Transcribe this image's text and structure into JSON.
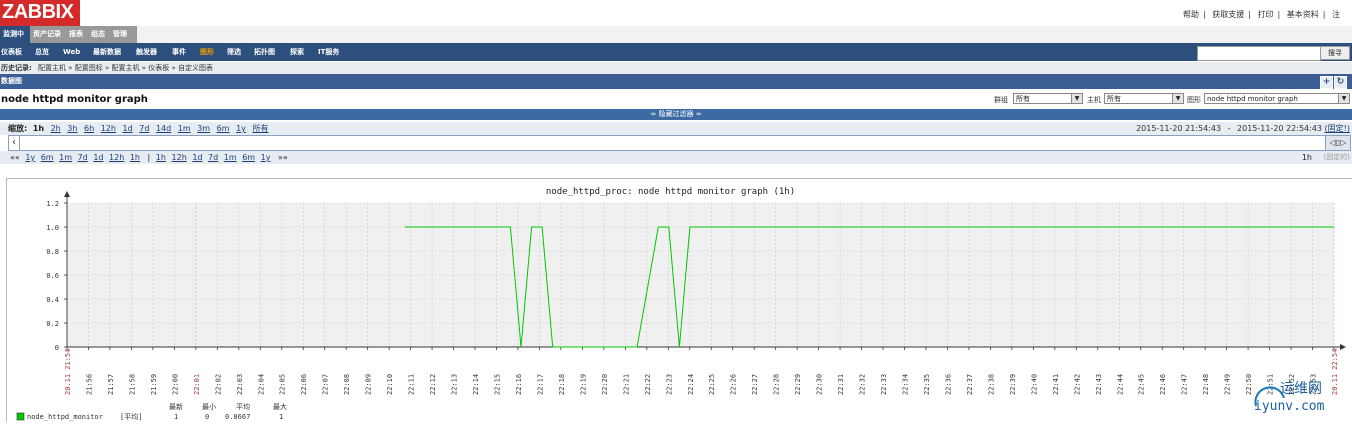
{
  "header": {
    "logo": "ZABBIX",
    "top_links": [
      "帮助",
      "获取支援",
      "打印",
      "基本资料",
      "注"
    ]
  },
  "topnav": [
    {
      "label": "监测中",
      "active": true
    },
    {
      "label": "资产记录"
    },
    {
      "label": "报表"
    },
    {
      "label": "组态"
    },
    {
      "label": "管理"
    }
  ],
  "menu": [
    "仪表板",
    "总览",
    "Web",
    "最新数据",
    "触发器",
    "事件",
    "图形",
    "筛选",
    "拓扑图",
    "探索",
    "IT服务"
  ],
  "menu_active_index": 6,
  "search": {
    "value": "",
    "button": "搜寻"
  },
  "history": {
    "label": "历史记录:",
    "items": [
      "配置主机",
      "配置图标",
      "配置主机",
      "仪表板",
      "自定义图表"
    ]
  },
  "section_title": "数据图",
  "page_title": "node httpd monitor graph",
  "filters": {
    "group_label": "群组",
    "group_value": "所有",
    "host_label": "主机",
    "host_value": "所有",
    "graph_label": "图形",
    "graph_value": "node httpd monitor graph"
  },
  "filter_toggle": "≈ 隐藏过滤器 ≈",
  "zoom": {
    "label": "缩放:",
    "options": [
      "1h",
      "2h",
      "3h",
      "6h",
      "12h",
      "1d",
      "7d",
      "14d",
      "1m",
      "3m",
      "6m",
      "1y",
      "所有"
    ],
    "active": "1h",
    "range_from": "2015-11-20 21:54:43",
    "range_sep": "-",
    "range_to": "2015-11-20 22:54:43",
    "range_tag": "(固定!)"
  },
  "period": {
    "back": "««",
    "back_options": [
      "1y",
      "6m",
      "1m",
      "7d",
      "1d",
      "12h",
      "1h"
    ],
    "sep": "|",
    "fwd_options": [
      "1h",
      "12h",
      "1d",
      "7d",
      "1m",
      "6m",
      "1y"
    ],
    "fwd": "»»",
    "current": "1h",
    "fixed": "(固定的)"
  },
  "chart_data": {
    "type": "line",
    "title": "node_httpd_proc: node httpd monitor graph (1h)",
    "y_ticks": [
      "0",
      "0.2",
      "0.4",
      "0.6",
      "0.8",
      "1.0",
      "1.2"
    ],
    "ylim": [
      0,
      1.2
    ],
    "x_ticks": [
      "20.11 21:54",
      "21:56",
      "21:57",
      "21:58",
      "21:59",
      "22:00",
      "22:01",
      "22:02",
      "22:03",
      "22:04",
      "22:05",
      "22:06",
      "22:07",
      "22:08",
      "22:09",
      "22:10",
      "22:11",
      "22:12",
      "22:13",
      "22:14",
      "22:15",
      "22:16",
      "22:17",
      "22:18",
      "22:19",
      "22:20",
      "22:21",
      "22:22",
      "22:23",
      "22:24",
      "22:25",
      "22:26",
      "22:27",
      "22:28",
      "22:29",
      "22:30",
      "22:31",
      "22:32",
      "22:33",
      "22:34",
      "22:35",
      "22:36",
      "22:37",
      "22:38",
      "22:39",
      "22:40",
      "22:41",
      "22:42",
      "22:43",
      "22:44",
      "22:45",
      "22:46",
      "22:47",
      "22:48",
      "22:49",
      "22:50",
      "22:51",
      "22:52",
      "22:53",
      "20.11 22:54"
    ],
    "series": [
      {
        "name": "node_httpd_monitor",
        "color": "#00c800",
        "points": [
          [
            "22:10",
            1
          ],
          [
            "22:15",
            1
          ],
          [
            "22:15:30",
            0
          ],
          [
            "22:16",
            1
          ],
          [
            "22:16:30",
            1
          ],
          [
            "22:17",
            0
          ],
          [
            "22:21",
            0
          ],
          [
            "22:22",
            1
          ],
          [
            "22:22:30",
            1
          ],
          [
            "22:23",
            0
          ],
          [
            "22:23:30",
            1
          ],
          [
            "22:54",
            1
          ]
        ]
      }
    ],
    "legend": {
      "headers": [
        "最新",
        "最小",
        "平均",
        "最大"
      ],
      "func": "[平均]",
      "values": [
        "1",
        "0",
        "0.8667",
        "1"
      ]
    },
    "grid": true,
    "colors": {
      "grid": "#c8c8c8",
      "axis": "#333333",
      "red_tick": "#aa3333"
    }
  },
  "watermark": {
    "text1": "运维网",
    "text2": "iyunv.com"
  }
}
